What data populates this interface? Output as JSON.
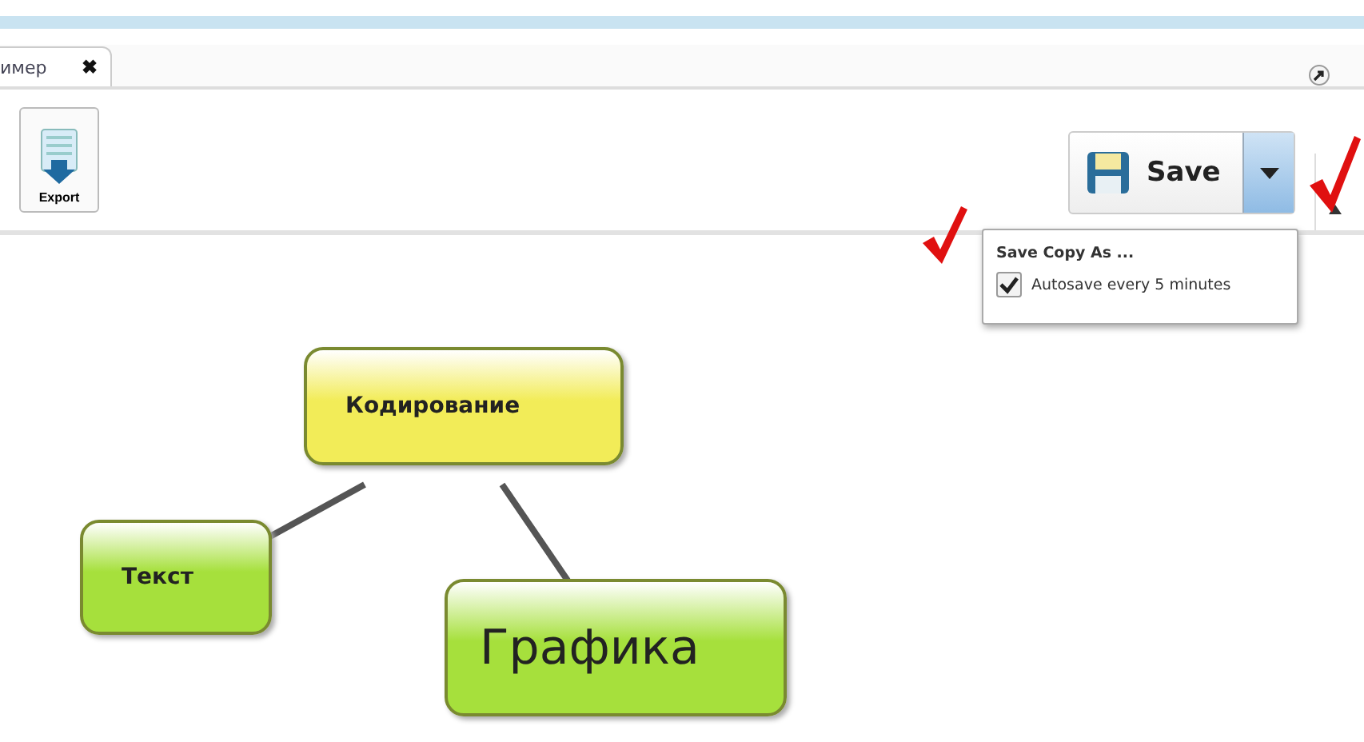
{
  "tab": {
    "label": "имер",
    "close": "✖"
  },
  "toolbar": {
    "export": "Export",
    "save": "Save"
  },
  "save_menu": {
    "expanded": true,
    "items": [
      {
        "kind": "action",
        "label": "Save Copy As ..."
      },
      {
        "kind": "check",
        "label": "Autosave every 5 minutes",
        "checked": true
      }
    ]
  },
  "mind_map": {
    "nodes": [
      {
        "label": "Кодирование",
        "color": "#f2ec58"
      },
      {
        "label": "Текст",
        "color": "#a6e03c"
      },
      {
        "label": "Графика",
        "color": "#a6e03c"
      }
    ]
  }
}
